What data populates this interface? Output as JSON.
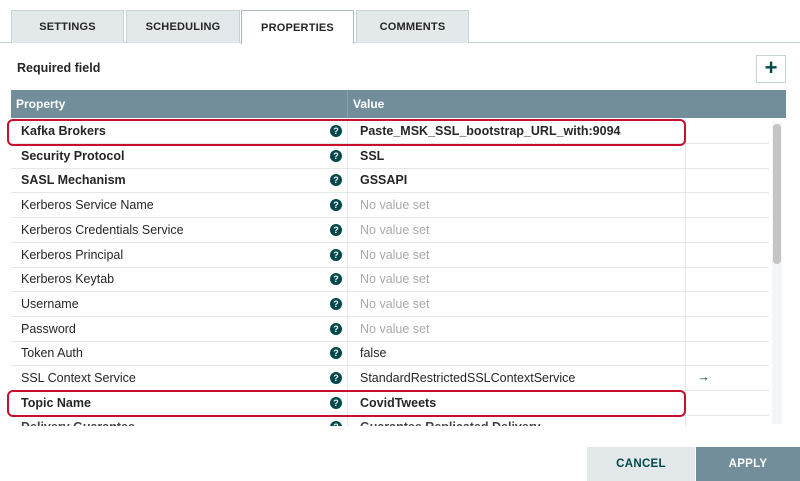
{
  "tabs": [
    {
      "label": "SETTINGS",
      "active": false
    },
    {
      "label": "SCHEDULING",
      "active": false
    },
    {
      "label": "PROPERTIES",
      "active": true
    },
    {
      "label": "COMMENTS",
      "active": false
    }
  ],
  "required_field_label": "Required field",
  "add_icon": "+",
  "grid": {
    "col_property": "Property",
    "col_value": "Value",
    "rows": [
      {
        "name": "Kafka Brokers",
        "value": "Paste_MSK_SSL_bootstrap_URL_with:9094",
        "required": true,
        "empty": false,
        "highlighted": true
      },
      {
        "name": "Security Protocol",
        "value": "SSL",
        "required": true,
        "empty": false
      },
      {
        "name": "SASL Mechanism",
        "value": "GSSAPI",
        "required": true,
        "empty": false
      },
      {
        "name": "Kerberos Service Name",
        "value": "No value set",
        "required": false,
        "empty": true
      },
      {
        "name": "Kerberos Credentials Service",
        "value": "No value set",
        "required": false,
        "empty": true
      },
      {
        "name": "Kerberos Principal",
        "value": "No value set",
        "required": false,
        "empty": true
      },
      {
        "name": "Kerberos Keytab",
        "value": "No value set",
        "required": false,
        "empty": true
      },
      {
        "name": "Username",
        "value": "No value set",
        "required": false,
        "empty": true
      },
      {
        "name": "Password",
        "value": "No value set",
        "required": false,
        "empty": true
      },
      {
        "name": "Token Auth",
        "value": "false",
        "required": false,
        "empty": false
      },
      {
        "name": "SSL Context Service",
        "value": "StandardRestrictedSSLContextService",
        "required": false,
        "empty": false,
        "action": "→"
      },
      {
        "name": "Topic Name",
        "value": "CovidTweets",
        "required": true,
        "empty": false,
        "highlighted": true
      },
      {
        "name": "Delivery Guarantee",
        "value": "Guarantee Replicated Delivery",
        "required": true,
        "empty": false
      }
    ]
  },
  "help_icon": "?",
  "buttons": {
    "cancel": "CANCEL",
    "apply": "APPLY"
  },
  "colors": {
    "header": "#728e9b",
    "accent": "#004849",
    "highlight": "#c8102e"
  }
}
